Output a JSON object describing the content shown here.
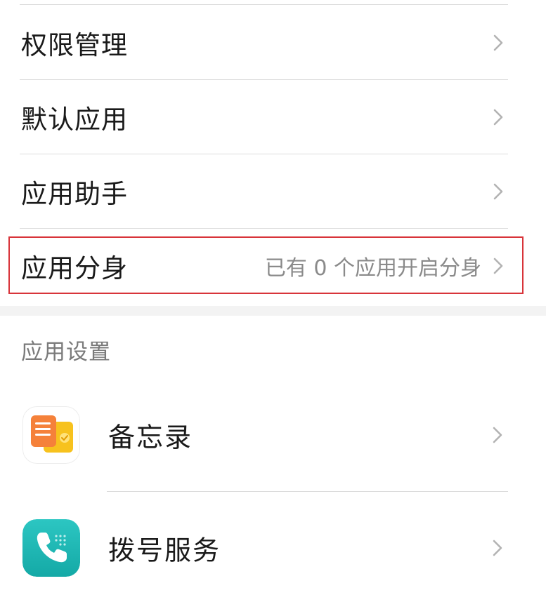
{
  "menu": {
    "items": [
      {
        "label": "权限管理",
        "value": ""
      },
      {
        "label": "默认应用",
        "value": ""
      },
      {
        "label": "应用助手",
        "value": ""
      },
      {
        "label": "应用分身",
        "value": "已有 0 个应用开启分身"
      }
    ]
  },
  "app_settings": {
    "section_title": "应用设置",
    "apps": [
      {
        "label": "备忘录",
        "icon": "notes-app-icon"
      },
      {
        "label": "拨号服务",
        "icon": "phone-app-icon"
      }
    ]
  },
  "colors": {
    "highlight_border": "#d8343a",
    "notes_orange": "#f5813a",
    "notes_yellow": "#f7c21e",
    "phone_teal": "#1fb8b4"
  }
}
